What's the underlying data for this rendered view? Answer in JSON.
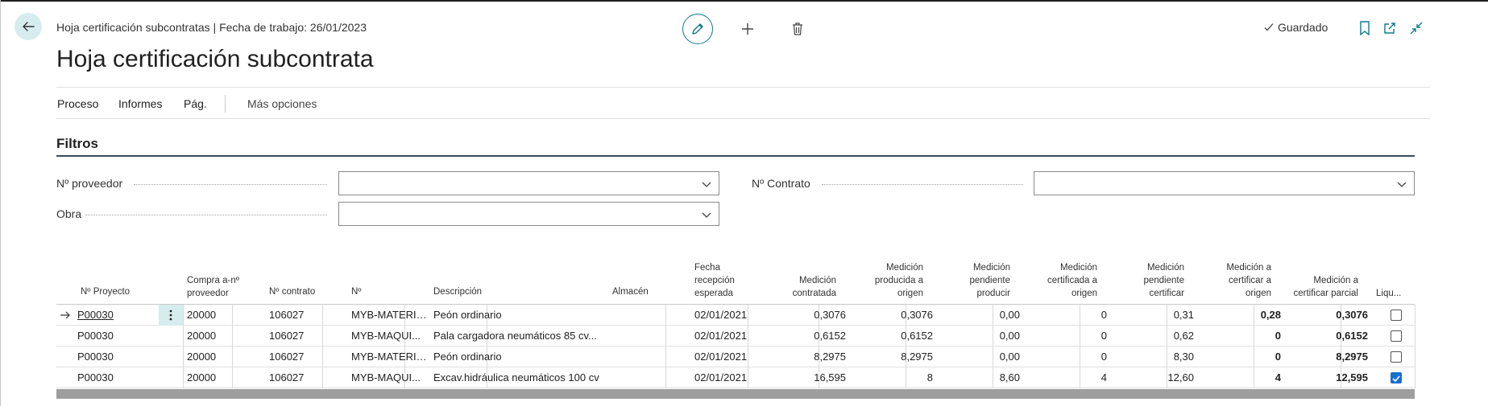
{
  "header": {
    "breadcrumb": "Hoja certificación subcontratas | Fecha de trabajo: 26/01/2023",
    "title": "Hoja certificación subcontrata",
    "saved_label": "Guardado"
  },
  "actions": [
    "Proceso",
    "Informes",
    "Pág.",
    "Más opciones"
  ],
  "filters": {
    "title": "Filtros",
    "proveedor_label": "Nº proveedor",
    "proveedor_value": "",
    "contrato_label": "Nº Contrato",
    "contrato_value": "",
    "obra_label": "Obra",
    "obra_value": ""
  },
  "table": {
    "columns": {
      "proyecto": "Nº Proyecto",
      "compra_1": "Compra a-nº",
      "compra_2": "proveedor",
      "contrato": "Nº contrato",
      "no": "Nº",
      "descripcion": "Descripción",
      "almacen": "Almacén",
      "fecha_1": "Fecha",
      "fecha_2": "recepción",
      "fecha_3": "esperada",
      "med_contr_1": "Medición",
      "med_contr_2": "contratada",
      "med_prod_1": "Medición",
      "med_prod_2": "producida a",
      "med_prod_3": "origen",
      "med_pend_1": "Medición",
      "med_pend_2": "pendiente",
      "med_pend_3": "producir",
      "med_cert_1": "Medición",
      "med_cert_2": "certificada a",
      "med_cert_3": "origen",
      "med_pcert_1": "Medición",
      "med_pcert_2": "pendiente",
      "med_pcert_3": "certificar",
      "med_acert_1": "Medición a",
      "med_acert_2": "certificar a",
      "med_acert_3": "origen",
      "med_parc_1": "Medición a",
      "med_parc_2": "certificar parcial",
      "liq": "Liqu..."
    },
    "rows": [
      {
        "proyecto": "P00030",
        "compra": "20000",
        "contrato": "106027",
        "no": "MYB-MATERIAL",
        "descripcion": "Peón ordinario",
        "almacen": "",
        "fecha": "02/01/2021",
        "med_contratada": "0,3076",
        "med_producida": "0,3076",
        "med_pend_producir": "0,00",
        "med_certificada": "0",
        "med_pend_certificar": "0,31",
        "med_a_certificar": "0,28",
        "med_parcial": "0,3076",
        "liquidado": false
      },
      {
        "proyecto": "P00030",
        "compra": "20000",
        "contrato": "106027",
        "no": "MYB-MAQUI...",
        "descripcion": "Pala cargadora neumáticos 85 cv...",
        "almacen": "",
        "fecha": "02/01/2021",
        "med_contratada": "0,6152",
        "med_producida": "0,6152",
        "med_pend_producir": "0,00",
        "med_certificada": "0",
        "med_pend_certificar": "0,62",
        "med_a_certificar": "0",
        "med_parcial": "0,6152",
        "liquidado": false
      },
      {
        "proyecto": "P00030",
        "compra": "20000",
        "contrato": "106027",
        "no": "MYB-MATERIAL",
        "descripcion": "Peón ordinario",
        "almacen": "",
        "fecha": "02/01/2021",
        "med_contratada": "8,2975",
        "med_producida": "8,2975",
        "med_pend_producir": "0,00",
        "med_certificada": "0",
        "med_pend_certificar": "8,30",
        "med_a_certificar": "0",
        "med_parcial": "8,2975",
        "liquidado": false
      },
      {
        "proyecto": "P00030",
        "compra": "20000",
        "contrato": "106027",
        "no": "MYB-MAQUI...",
        "descripcion": "Excav.hidráulica neumáticos 100 cv",
        "almacen": "",
        "fecha": "02/01/2021",
        "med_contratada": "16,595",
        "med_producida": "8",
        "med_pend_producir": "8,60",
        "med_certificada": "4",
        "med_pend_certificar": "12,60",
        "med_a_certificar": "4",
        "med_parcial": "12,595",
        "liquidado": true
      }
    ]
  },
  "colors": {
    "accent": "#0f7a8a",
    "selected_bg": "#d6ecef",
    "checkbox_on": "#1a6fd0"
  }
}
